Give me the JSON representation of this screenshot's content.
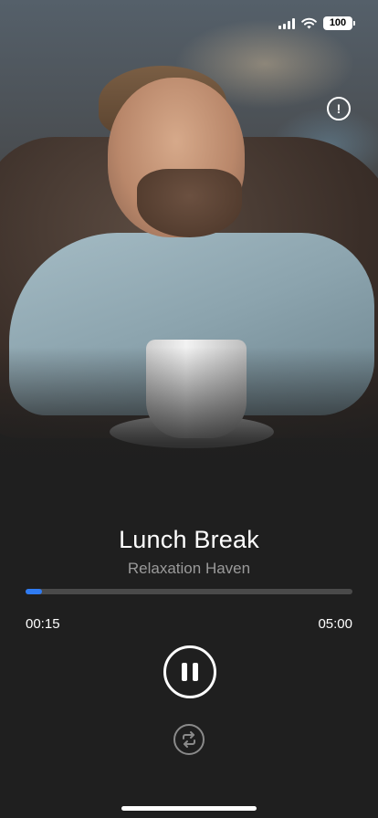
{
  "status_bar": {
    "battery": "100",
    "icons": [
      "cellular-signal-icon",
      "wifi-icon",
      "battery-icon"
    ]
  },
  "hero": {
    "description_icon": "info-icon",
    "info_symbol": "!"
  },
  "track": {
    "title": "Lunch Break",
    "artist": "Relaxation Haven"
  },
  "playback": {
    "current_time": "00:15",
    "total_time": "05:00",
    "progress_fraction": 0.05,
    "state": "playing"
  },
  "controls": {
    "primary": "pause-icon",
    "secondary": "repeat-icon"
  },
  "colors": {
    "accent": "#2f7bf2",
    "background": "#1f1f1f",
    "subtitle": "#9a9a9a",
    "track": "#4a4a4a"
  }
}
